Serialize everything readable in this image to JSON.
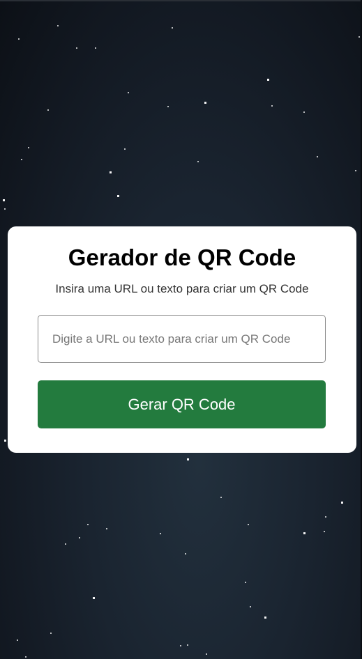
{
  "card": {
    "title": "Gerador de QR Code",
    "subtitle": "Insira uma URL ou texto para criar um QR Code",
    "input_placeholder": "Digite a URL ou texto para criar um QR Code",
    "input_value": "",
    "button_label": "Gerar QR Code"
  },
  "colors": {
    "background": "#161e28",
    "card": "#ffffff",
    "button": "#237b3e",
    "button_text": "#ffffff"
  }
}
